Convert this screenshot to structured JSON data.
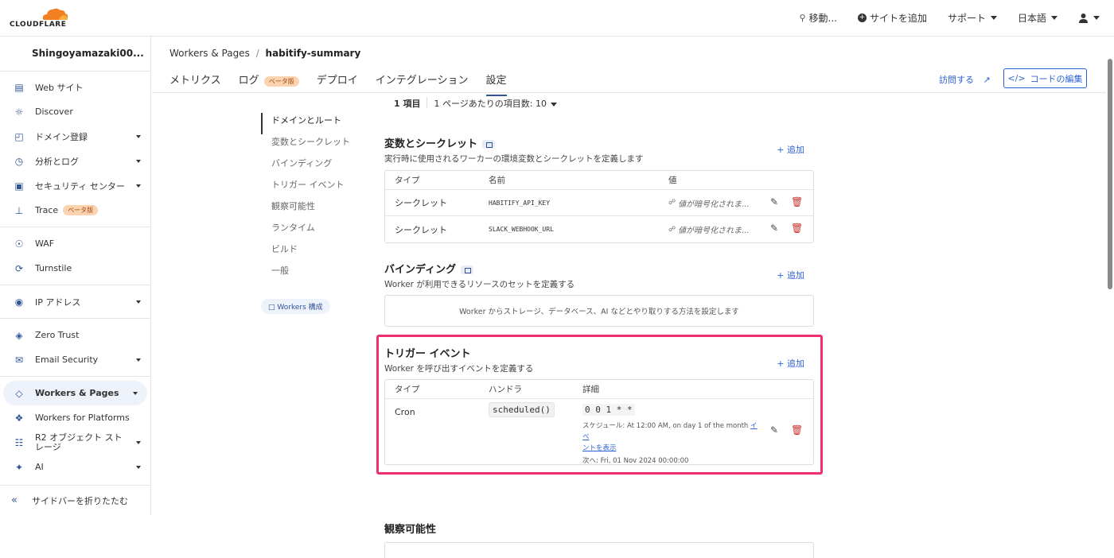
{
  "brand": {
    "logo_text": "CLOUDFLARE",
    "accent": "#f38020"
  },
  "topnav": {
    "search": "移動...",
    "add_site": "サイトを追加",
    "support": "サポート",
    "language": "日本語"
  },
  "sidebar": {
    "account": "Shingoyamazaki00...",
    "items": [
      {
        "label": "Web サイト",
        "icon": "browser-icon"
      },
      {
        "label": "Discover",
        "icon": "lightbulb-icon"
      },
      {
        "label": "ドメイン登録",
        "icon": "globe-icon"
      },
      {
        "label": "分析とログ",
        "icon": "chart-icon"
      },
      {
        "label": "セキュリティ センター",
        "icon": "security-center-icon"
      },
      {
        "label": "Trace",
        "icon": "trace-icon",
        "badge": "ベータ版"
      },
      {
        "label": "WAF",
        "icon": "waf-icon"
      },
      {
        "label": "Turnstile",
        "icon": "turnstile-icon"
      },
      {
        "label": "IP アドレス",
        "icon": "location-icon"
      },
      {
        "label": "Zero Trust",
        "icon": "zero-trust-icon"
      },
      {
        "label": "Email Security",
        "icon": "email-icon"
      },
      {
        "label": "Workers & Pages",
        "icon": "workers-icon"
      },
      {
        "label": "Workers for Platforms",
        "icon": "platforms-icon"
      },
      {
        "label": "R2 オブジェクト ストレージ",
        "icon": "r2-icon"
      },
      {
        "label": "AI",
        "icon": "ai-icon"
      }
    ],
    "collapse": "サイドバーを折りたたむ"
  },
  "main": {
    "breadcrumb_root": "Workers & Pages",
    "breadcrumb_sep": "/",
    "breadcrumb_current": "habitify-summary",
    "tabs": [
      {
        "label": "メトリクス"
      },
      {
        "label": "ログ",
        "badge": "ベータ版"
      },
      {
        "label": "デプロイ"
      },
      {
        "label": "インテグレーション"
      },
      {
        "label": "設定"
      }
    ],
    "visit": "訪問する",
    "edit_code": "コードの編集"
  },
  "settings_nav": {
    "items": [
      "ドメインとルート",
      "変数とシークレット",
      "バインディング",
      "トリガー イベント",
      "観察可能性",
      "ランタイム",
      "ビルド",
      "一般"
    ],
    "workers_config": "Workers 構成"
  },
  "pager": {
    "count": "1 項目",
    "per_page": "1 ページあたりの項目数: 10"
  },
  "variables": {
    "title": "変数とシークレット",
    "desc": "実行時に使用されるワーカーの環境変数とシークレットを定義します",
    "add": "+ 追加",
    "headers": [
      "タイプ",
      "名前",
      "値"
    ],
    "rows": [
      {
        "type": "シークレット",
        "name": "HABITIFY_API_KEY",
        "value": "値が暗号化されま..."
      },
      {
        "type": "シークレット",
        "name": "SLACK_WEBHOOK_URL",
        "value": "値が暗号化されま..."
      }
    ]
  },
  "bindings": {
    "title": "バインディング",
    "desc": "Worker が利用できるリソースのセットを定義する",
    "add": "+ 追加",
    "empty": "Worker からストレージ、データベース、AI などとやり取りする方法を設定します"
  },
  "triggers": {
    "title": "トリガー イベント",
    "desc": "Worker を呼び出すイベントを定義する",
    "add": "+ 追加",
    "headers": [
      "タイプ",
      "ハンドラ",
      "詳細"
    ],
    "row": {
      "type": "Cron",
      "handler": "scheduled()",
      "cron": "0 0 1 * *",
      "schedule_prefix": "スケジュール: At 12:00 AM, on day 1 of the month",
      "events_link_a": "イベ",
      "events_link_b": "ントを表示",
      "next": "次へ: Fri, 01 Nov 2024 00:00:00"
    }
  },
  "observability": {
    "title": "観察可能性"
  }
}
